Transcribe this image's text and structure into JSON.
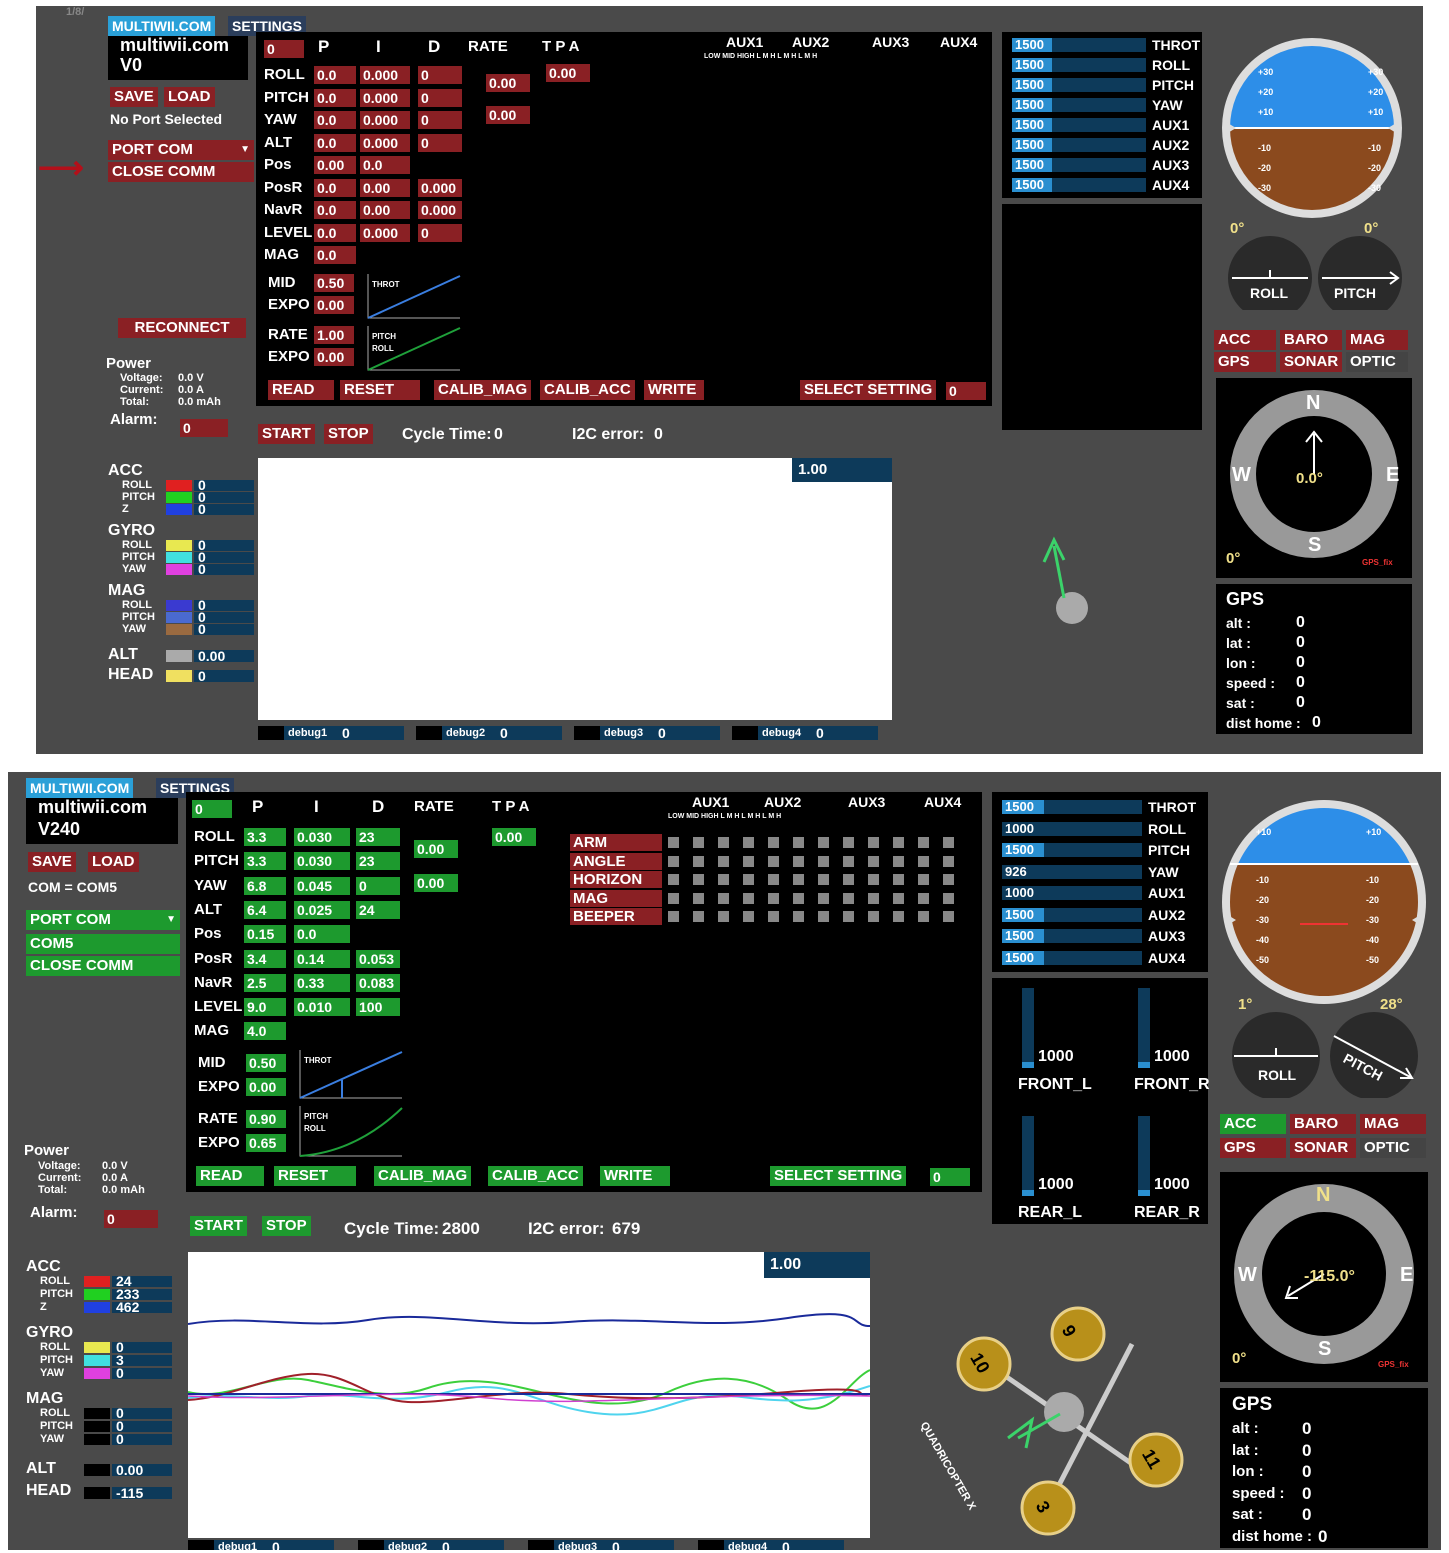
{
  "top": {
    "corner": "1/8/",
    "tab_multiwii": "MULTIWII.COM",
    "tab_settings": "SETTINGS",
    "site": "multiwii.com",
    "version": "V0",
    "save": "SAVE",
    "load": "LOAD",
    "port_status": "No Port Selected",
    "port_com": "PORT COM",
    "close_comm": "CLOSE COMM",
    "reconnect": "RECONNECT",
    "power": {
      "title": "Power",
      "voltage_label": "Voltage:",
      "voltage": "0.0 V",
      "current_label": "Current:",
      "current": "0.0 A",
      "total_label": "Total:",
      "total": "0.0 mAh",
      "alarm_label": "Alarm:",
      "alarm": "0"
    },
    "pid_headers": {
      "sel": "0",
      "p": "P",
      "i": "I",
      "d": "D",
      "rate": "RATE",
      "tpa": "T P A"
    },
    "pid_rows": [
      {
        "name": "ROLL",
        "p": "0.0",
        "i": "0.000",
        "d": "0"
      },
      {
        "name": "PITCH",
        "p": "0.0",
        "i": "0.000",
        "d": "0"
      },
      {
        "name": "YAW",
        "p": "0.0",
        "i": "0.000",
        "d": "0"
      },
      {
        "name": "ALT",
        "p": "0.0",
        "i": "0.000",
        "d": "0"
      },
      {
        "name": "Pos",
        "p": "0.00",
        "i": "0.0",
        "d": ""
      },
      {
        "name": "PosR",
        "p": "0.0",
        "i": "0.00",
        "d": "0.000"
      },
      {
        "name": "NavR",
        "p": "0.0",
        "i": "0.00",
        "d": "0.000"
      },
      {
        "name": "LEVEL",
        "p": "0.0",
        "i": "0.000",
        "d": "0"
      },
      {
        "name": "MAG",
        "p": "0.0",
        "i": "",
        "d": ""
      }
    ],
    "rate_rp": "0.00",
    "rate_yaw": "0.00",
    "tpa": "0.00",
    "mid_label": "MID",
    "mid": "0.50",
    "expo_label": "EXPO",
    "expo": "0.00",
    "rate_label": "RATE",
    "rate": "1.00",
    "expo2_label": "EXPO",
    "expo2": "0.00",
    "throt_label": "THROT",
    "pitch_label": "PITCH",
    "roll_label": "ROLL",
    "read": "READ",
    "reset": "RESET",
    "calib_mag": "CALIB_MAG",
    "calib_acc": "CALIB_ACC",
    "write": "WRITE",
    "select_setting": "SELECT SETTING",
    "setting_val": "0",
    "aux_headers": [
      "AUX1",
      "AUX2",
      "AUX3",
      "AUX4"
    ],
    "lmh": "LOW MID HIGH  L  M  H  L  M  H  L  M  H",
    "rc": [
      {
        "v": "1500",
        "n": "THROT",
        "f": 0.3
      },
      {
        "v": "1500",
        "n": "ROLL",
        "f": 0.3
      },
      {
        "v": "1500",
        "n": "PITCH",
        "f": 0.3
      },
      {
        "v": "1500",
        "n": "YAW",
        "f": 0.3
      },
      {
        "v": "1500",
        "n": "AUX1",
        "f": 0.3
      },
      {
        "v": "1500",
        "n": "AUX2",
        "f": 0.3
      },
      {
        "v": "1500",
        "n": "AUX3",
        "f": 0.3
      },
      {
        "v": "1500",
        "n": "AUX4",
        "f": 0.3
      }
    ],
    "start": "START",
    "stop": "STOP",
    "cycle_label": "Cycle Time:",
    "cycle": "0",
    "i2c_label": "I2C error:",
    "i2c": "0",
    "scale": "1.00",
    "sensors": {
      "acc": "ACC",
      "gyro": "GYRO",
      "mag": "MAG",
      "alt": "ALT",
      "head": "HEAD",
      "roll": "ROLL",
      "pitch": "PITCH",
      "z": "Z",
      "yaw": "YAW",
      "acc_v": [
        "0",
        "0",
        "0"
      ],
      "gyro_v": [
        "0",
        "0",
        "0"
      ],
      "mag_v": [
        "0",
        "0",
        "0"
      ],
      "alt_v": "0.00",
      "head_v": "0"
    },
    "debug": [
      "debug1",
      "debug2",
      "debug3",
      "debug4"
    ],
    "debug_v": [
      "0",
      "0",
      "0",
      "0"
    ],
    "roll_deg": "0°",
    "pitch_deg": "0°",
    "roll_btn": "ROLL",
    "pitch_btn": "PITCH",
    "flags": [
      "ACC",
      "BARO",
      "MAG",
      "GPS",
      "SONAR",
      "OPTIC"
    ],
    "compass": {
      "n": "N",
      "e": "E",
      "s": "S",
      "w": "W",
      "heading": "0.0°",
      "deg": "0°",
      "fix": "GPS_fix"
    },
    "gps": {
      "title": "GPS",
      "alt": "alt :",
      "lat": "lat :",
      "lon": "lon :",
      "speed": "speed :",
      "sat": "sat :",
      "home": "dist home :",
      "v": [
        "0",
        "0",
        "0",
        "0",
        "0",
        "0"
      ]
    },
    "horizon": [
      "+30",
      "+20",
      "+10",
      "-10",
      "-20",
      "-30"
    ]
  },
  "bottom": {
    "tab_multiwii": "MULTIWII.COM",
    "tab_settings": "SETTINGS",
    "site": "multiwii.com",
    "version": "V240",
    "save": "SAVE",
    "load": "LOAD",
    "port_status": "COM = COM5",
    "port_com": "PORT COM",
    "com5": "COM5",
    "close_comm": "CLOSE COMM",
    "power": {
      "title": "Power",
      "voltage_label": "Voltage:",
      "voltage": "0.0 V",
      "current_label": "Current:",
      "current": "0.0 A",
      "total_label": "Total:",
      "total": "0.0 mAh",
      "alarm_label": "Alarm:",
      "alarm": "0"
    },
    "pid_headers": {
      "sel": "0",
      "p": "P",
      "i": "I",
      "d": "D",
      "rate": "RATE",
      "tpa": "T P A"
    },
    "pid_rows": [
      {
        "name": "ROLL",
        "p": "3.3",
        "i": "0.030",
        "d": "23"
      },
      {
        "name": "PITCH",
        "p": "3.3",
        "i": "0.030",
        "d": "23"
      },
      {
        "name": "YAW",
        "p": "6.8",
        "i": "0.045",
        "d": "0"
      },
      {
        "name": "ALT",
        "p": "6.4",
        "i": "0.025",
        "d": "24"
      },
      {
        "name": "Pos",
        "p": "0.15",
        "i": "0.0",
        "d": ""
      },
      {
        "name": "PosR",
        "p": "3.4",
        "i": "0.14",
        "d": "0.053"
      },
      {
        "name": "NavR",
        "p": "2.5",
        "i": "0.33",
        "d": "0.083"
      },
      {
        "name": "LEVEL",
        "p": "9.0",
        "i": "0.010",
        "d": "100"
      },
      {
        "name": "MAG",
        "p": "4.0",
        "i": "",
        "d": ""
      }
    ],
    "rate_rp": "0.00",
    "rate_yaw": "0.00",
    "tpa": "0.00",
    "mid_label": "MID",
    "mid": "0.50",
    "expo_label": "EXPO",
    "expo": "0.00",
    "rate_label": "RATE",
    "rate": "0.90",
    "expo2_label": "EXPO",
    "expo2": "0.65",
    "throt_label": "THROT",
    "pitch_label": "PITCH",
    "roll_label": "ROLL",
    "read": "READ",
    "reset": "RESET",
    "calib_mag": "CALIB_MAG",
    "calib_acc": "CALIB_ACC",
    "write": "WRITE",
    "select_setting": "SELECT SETTING",
    "setting_val": "0",
    "aux_headers": [
      "AUX1",
      "AUX2",
      "AUX3",
      "AUX4"
    ],
    "lmh": "LOW MID HIGH  L  M  H  L  M  H  L  M  H",
    "modes": [
      "ARM",
      "ANGLE",
      "HORIZON",
      "MAG",
      "BEEPER"
    ],
    "rc": [
      {
        "v": "1500",
        "n": "THROT",
        "f": 0.3
      },
      {
        "v": "1000",
        "n": "ROLL",
        "f": 0.0
      },
      {
        "v": "1500",
        "n": "PITCH",
        "f": 0.3
      },
      {
        "v": "926",
        "n": "YAW",
        "f": 0.0
      },
      {
        "v": "1000",
        "n": "AUX1",
        "f": 0.0
      },
      {
        "v": "1500",
        "n": "AUX2",
        "f": 0.3
      },
      {
        "v": "1500",
        "n": "AUX3",
        "f": 0.3
      },
      {
        "v": "1500",
        "n": "AUX4",
        "f": 0.3
      }
    ],
    "motors": [
      {
        "v": "1000",
        "n": "FRONT_L"
      },
      {
        "v": "1000",
        "n": "FRONT_R"
      },
      {
        "v": "1000",
        "n": "REAR_L"
      },
      {
        "v": "1000",
        "n": "REAR_R"
      }
    ],
    "start": "START",
    "stop": "STOP",
    "cycle_label": "Cycle Time:",
    "cycle": "2800",
    "i2c_label": "I2C error:",
    "i2c": "679",
    "scale": "1.00",
    "sensors": {
      "acc": "ACC",
      "gyro": "GYRO",
      "mag": "MAG",
      "alt": "ALT",
      "head": "HEAD",
      "roll": "ROLL",
      "pitch": "PITCH",
      "z": "Z",
      "yaw": "YAW",
      "acc_v": [
        "24",
        "233",
        "462"
      ],
      "gyro_v": [
        "0",
        "3",
        "0"
      ],
      "mag_v": [
        "0",
        "0",
        "0"
      ],
      "alt_v": "0.00",
      "head_v": "-115"
    },
    "debug": [
      "debug1",
      "debug2",
      "debug3",
      "debug4"
    ],
    "debug_v": [
      "0",
      "0",
      "0",
      "0"
    ],
    "roll_deg": "1°",
    "pitch_deg": "28°",
    "roll_btn": "ROLL",
    "pitch_btn": "PITCH",
    "flags": [
      "ACC",
      "BARO",
      "MAG",
      "GPS",
      "SONAR",
      "OPTIC"
    ],
    "compass": {
      "n": "N",
      "e": "E",
      "s": "S",
      "w": "W",
      "heading": "-115.0°",
      "deg": "0°",
      "fix": "GPS_fix"
    },
    "gps": {
      "title": "GPS",
      "alt": "alt :",
      "lat": "lat :",
      "lon": "lon :",
      "speed": "speed :",
      "sat": "sat :",
      "home": "dist home :",
      "v": [
        "0",
        "0",
        "0",
        "0",
        "0",
        "0"
      ]
    },
    "horizon": [
      "+10",
      "-10",
      "-20",
      "-30",
      "-40",
      "-50"
    ],
    "quad_label": "QUADRICOPTER X",
    "props": [
      "9",
      "10",
      "11",
      "3"
    ]
  }
}
